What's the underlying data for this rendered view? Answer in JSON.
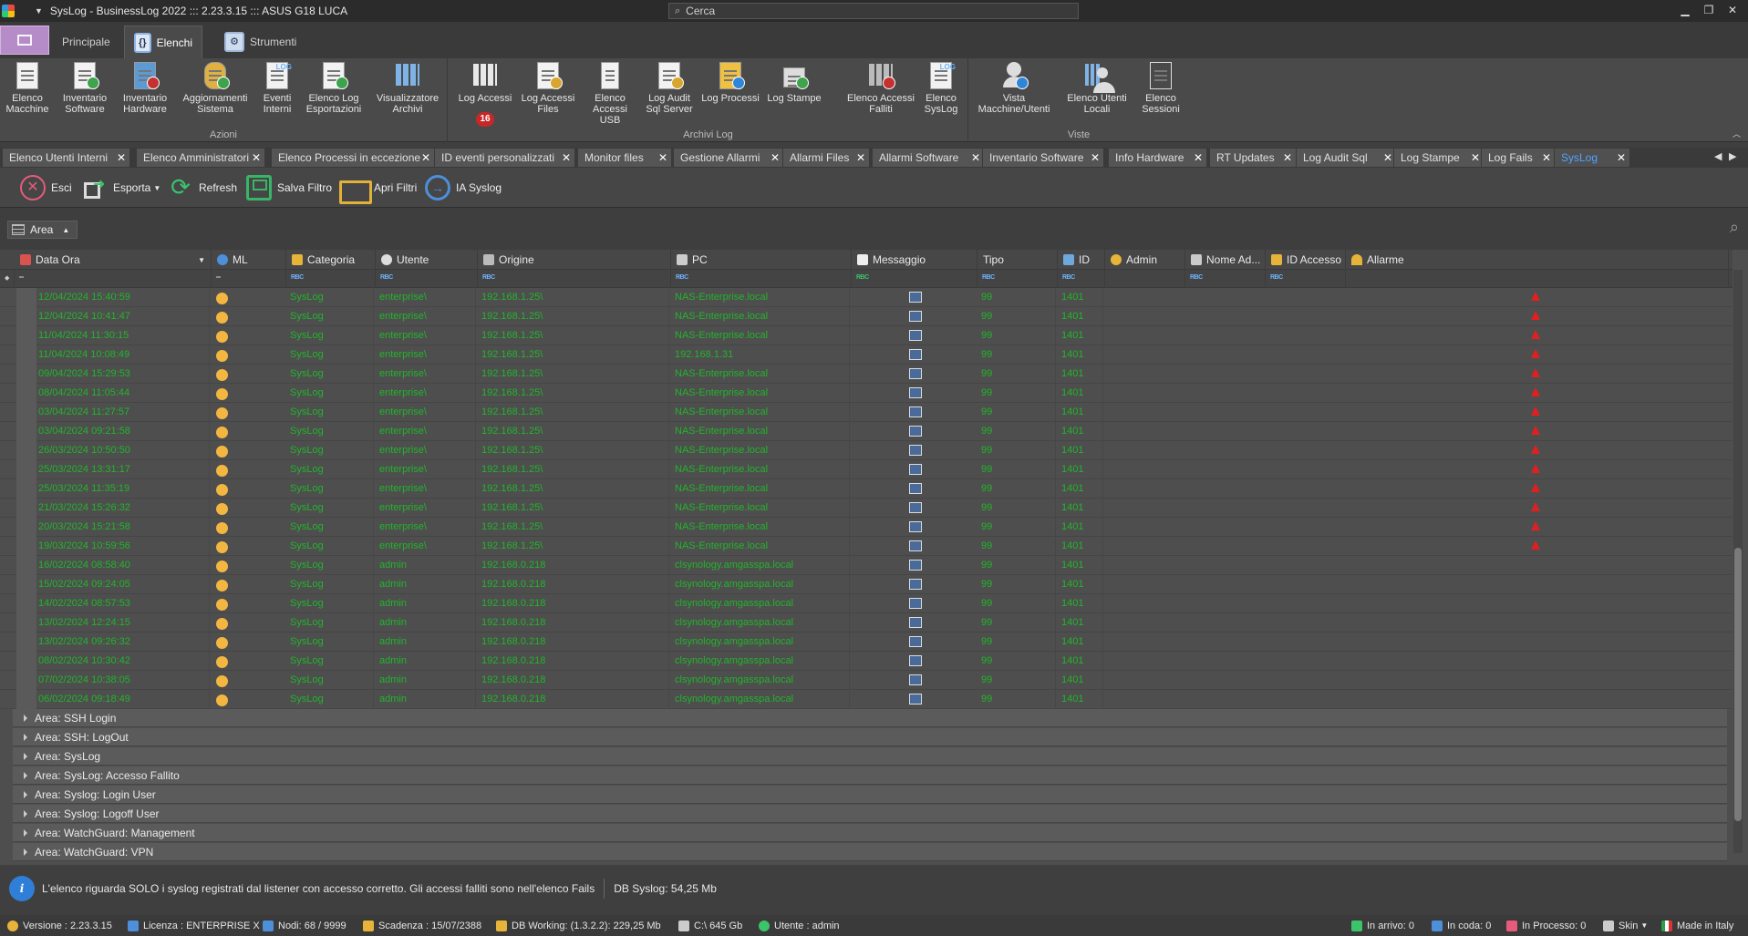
{
  "window": {
    "title": "SysLog - BusinessLog 2022 ::: 2.23.3.15 ::: ASUS G18 LUCA",
    "search_placeholder": "Cerca"
  },
  "ribbon_tabs": [
    "Principale",
    "Elenchi",
    "Strumenti"
  ],
  "ribbon_groups": {
    "azioni": {
      "label": "Azioni",
      "buttons": [
        [
          "Elenco",
          "Macchine"
        ],
        [
          "Inventario",
          "Software"
        ],
        [
          "Inventario",
          "Hardware"
        ],
        [
          "Aggiornamenti",
          "Sistema"
        ],
        [
          "Eventi",
          "Interni"
        ],
        [
          "Elenco Log",
          "Esportazioni"
        ],
        [
          "Visualizzatore",
          "Archivi"
        ]
      ]
    },
    "archivi": {
      "label": "Archivi Log",
      "notification_count": "16",
      "buttons": [
        [
          "Log Accessi",
          ""
        ],
        [
          "Log Accessi",
          "Files"
        ],
        [
          "Elenco",
          "Accessi USB"
        ],
        [
          "Log Audit",
          "Sql Server"
        ],
        [
          "Log Processi",
          ""
        ],
        [
          "Log Stampe",
          ""
        ],
        [
          "Elenco Accessi",
          "Falliti"
        ],
        [
          "Elenco",
          "SysLog"
        ]
      ]
    },
    "viste": {
      "label": "Viste",
      "buttons": [
        [
          "Vista",
          "Macchine/Utenti"
        ],
        [
          "Elenco Utenti",
          "Locali"
        ],
        [
          "Elenco",
          "Sessioni"
        ]
      ]
    }
  },
  "doc_tabs": [
    "Elenco Utenti Interni",
    "Elenco Amministratori",
    "Elenco Processi in eccezione",
    "ID eventi personalizzati",
    "Monitor files",
    "Gestione Allarmi",
    "Allarmi Files",
    "Allarmi Software",
    "Inventario Software",
    "Info Hardware",
    "RT Updates",
    "Log Audit Sql",
    "Log Stampe",
    "Log Fails",
    "SysLog"
  ],
  "toolbar": {
    "esci": "Esci",
    "esporta": "Esporta",
    "refresh": "Refresh",
    "salva_filtro": "Salva Filtro",
    "apri_filtri": "Apri Filtri",
    "ia_syslog": "IA Syslog"
  },
  "group_by": "Area",
  "columns": [
    "Data Ora",
    "ML",
    "Categoria",
    "Utente",
    "Origine",
    "PC",
    "Messaggio",
    "Tipo",
    "ID",
    "Admin",
    "Nome Ad...",
    "ID Accesso",
    "Allarme"
  ],
  "filter_placeholder": "RBC",
  "rows": [
    [
      "12/04/2024 15:40:59",
      "SysLog",
      "enterprise\\",
      "192.168.1.25\\",
      "NAS-Enterprise.local",
      "99",
      "1401",
      true
    ],
    [
      "12/04/2024 10:41:47",
      "SysLog",
      "enterprise\\",
      "192.168.1.25\\",
      "NAS-Enterprise.local",
      "99",
      "1401",
      true
    ],
    [
      "11/04/2024 11:30:15",
      "SysLog",
      "enterprise\\",
      "192.168.1.25\\",
      "NAS-Enterprise.local",
      "99",
      "1401",
      true
    ],
    [
      "11/04/2024 10:08:49",
      "SysLog",
      "enterprise\\",
      "192.168.1.25\\",
      "192.168.1.31",
      "99",
      "1401",
      true
    ],
    [
      "09/04/2024 15:29:53",
      "SysLog",
      "enterprise\\",
      "192.168.1.25\\",
      "NAS-Enterprise.local",
      "99",
      "1401",
      true
    ],
    [
      "08/04/2024 11:05:44",
      "SysLog",
      "enterprise\\",
      "192.168.1.25\\",
      "NAS-Enterprise.local",
      "99",
      "1401",
      true
    ],
    [
      "03/04/2024 11:27:57",
      "SysLog",
      "enterprise\\",
      "192.168.1.25\\",
      "NAS-Enterprise.local",
      "99",
      "1401",
      true
    ],
    [
      "03/04/2024 09:21:58",
      "SysLog",
      "enterprise\\",
      "192.168.1.25\\",
      "NAS-Enterprise.local",
      "99",
      "1401",
      true
    ],
    [
      "26/03/2024 10:50:50",
      "SysLog",
      "enterprise\\",
      "192.168.1.25\\",
      "NAS-Enterprise.local",
      "99",
      "1401",
      true
    ],
    [
      "25/03/2024 13:31:17",
      "SysLog",
      "enterprise\\",
      "192.168.1.25\\",
      "NAS-Enterprise.local",
      "99",
      "1401",
      true
    ],
    [
      "25/03/2024 11:35:19",
      "SysLog",
      "enterprise\\",
      "192.168.1.25\\",
      "NAS-Enterprise.local",
      "99",
      "1401",
      true
    ],
    [
      "21/03/2024 15:26:32",
      "SysLog",
      "enterprise\\",
      "192.168.1.25\\",
      "NAS-Enterprise.local",
      "99",
      "1401",
      true
    ],
    [
      "20/03/2024 15:21:58",
      "SysLog",
      "enterprise\\",
      "192.168.1.25\\",
      "NAS-Enterprise.local",
      "99",
      "1401",
      true
    ],
    [
      "19/03/2024 10:59:56",
      "SysLog",
      "enterprise\\",
      "192.168.1.25\\",
      "NAS-Enterprise.local",
      "99",
      "1401",
      true
    ],
    [
      "16/02/2024 08:58:40",
      "SysLog",
      "admin",
      "192.168.0.218",
      "clsynology.amgasspa.local",
      "99",
      "1401",
      false
    ],
    [
      "15/02/2024 09:24:05",
      "SysLog",
      "admin",
      "192.168.0.218",
      "clsynology.amgasspa.local",
      "99",
      "1401",
      false
    ],
    [
      "14/02/2024 08:57:53",
      "SysLog",
      "admin",
      "192.168.0.218",
      "clsynology.amgasspa.local",
      "99",
      "1401",
      false
    ],
    [
      "13/02/2024 12:24:15",
      "SysLog",
      "admin",
      "192.168.0.218",
      "clsynology.amgasspa.local",
      "99",
      "1401",
      false
    ],
    [
      "13/02/2024 09:26:32",
      "SysLog",
      "admin",
      "192.168.0.218",
      "clsynology.amgasspa.local",
      "99",
      "1401",
      false
    ],
    [
      "08/02/2024 10:30:42",
      "SysLog",
      "admin",
      "192.168.0.218",
      "clsynology.amgasspa.local",
      "99",
      "1401",
      false
    ],
    [
      "07/02/2024 10:38:05",
      "SysLog",
      "admin",
      "192.168.0.218",
      "clsynology.amgasspa.local",
      "99",
      "1401",
      false
    ],
    [
      "06/02/2024 09:18:49",
      "SysLog",
      "admin",
      "192.168.0.218",
      "clsynology.amgasspa.local",
      "99",
      "1401",
      false
    ]
  ],
  "group_rows": [
    "Area: SSH Login",
    "Area: SSH: LogOut",
    "Area: SysLog",
    "Area: SysLog: Accesso Fallito",
    "Area: Syslog: Login User",
    "Area: Syslog: Logoff User",
    "Area: WatchGuard: Management",
    "Area: WatchGuard: VPN"
  ],
  "info": {
    "message": "L'elenco riguarda SOLO i syslog registrati dal listener con accesso corretto. Gli accessi falliti sono nell'elenco Fails",
    "db_size": "DB Syslog: 54,25 Mb"
  },
  "status": {
    "versione": "Versione : 2.23.3.15",
    "licenza": "Licenza : ENTERPRISE X",
    "nodi": "Nodi: 68 / 9999",
    "scadenza": "Scadenza : 15/07/2388",
    "db": "DB Working: (1.3.2.2): 229,25 Mb",
    "disk": "C:\\ 645 Gb",
    "utente": "Utente : admin",
    "in_arrivo": "In arrivo: 0",
    "in_coda": "In coda: 0",
    "in_processo": "In Processo: 0",
    "skin": "Skin",
    "made": "Made in Italy"
  },
  "colors": {
    "row_text": "#21b52a",
    "accent": "#4fa3ff",
    "alarm": "#e02020"
  }
}
